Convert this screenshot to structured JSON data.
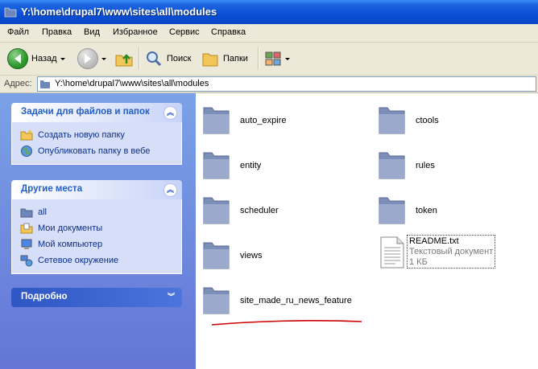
{
  "window": {
    "title": "Y:\\home\\drupal7\\www\\sites\\all\\modules"
  },
  "menu": {
    "items": [
      "Файл",
      "Правка",
      "Вид",
      "Избранное",
      "Сервис",
      "Справка"
    ]
  },
  "toolbar": {
    "back_label": "Назад",
    "search_label": "Поиск",
    "folders_label": "Папки"
  },
  "address": {
    "label": "Адрес:",
    "value": "Y:\\home\\drupal7\\www\\sites\\all\\modules"
  },
  "tasks_panel": {
    "title": "Задачи для файлов и папок",
    "items": [
      {
        "label": "Создать новую папку",
        "icon": "new-folder-icon"
      },
      {
        "label": "Опубликовать папку в вебе",
        "icon": "publish-web-icon"
      }
    ]
  },
  "places_panel": {
    "title": "Другие места",
    "items": [
      {
        "label": "all",
        "icon": "folder-icon"
      },
      {
        "label": "Мои документы",
        "icon": "my-documents-icon"
      },
      {
        "label": "Мой компьютер",
        "icon": "my-computer-icon"
      },
      {
        "label": "Сетевое окружение",
        "icon": "network-icon"
      }
    ]
  },
  "details_panel": {
    "title": "Подробно"
  },
  "files": {
    "folders": [
      "auto_expire",
      "ctools",
      "entity",
      "rules",
      "scheduler",
      "token",
      "views",
      "site_made_ru_news_feature"
    ],
    "readme": {
      "name": "README.txt",
      "type": "Текстовый документ",
      "size": "1 КБ"
    }
  },
  "colors": {
    "annotation_underline": "#cc0000",
    "title_bar": "#0a4fd6",
    "task_pane": "#6d8be0"
  }
}
